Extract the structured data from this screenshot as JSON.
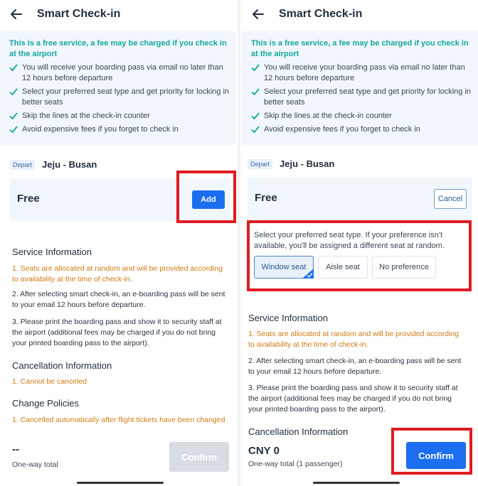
{
  "left": {
    "header": {
      "title": "Smart Check-in"
    },
    "notice": {
      "title": "This is a free service, a fee may be charged if you check in at the airport",
      "benefits": [
        "You will receive your boarding pass via email no later than 12 hours before departure",
        "Select your preferred seat type and get priority for locking in better seats",
        "Skip the lines at the check-in counter",
        "Avoid expensive fees if you forget to check in"
      ]
    },
    "route": {
      "badge": "Depart",
      "text": "Jeju - Busan"
    },
    "price": {
      "label": "Free",
      "add_label": "Add"
    },
    "service": {
      "title": "Service Information",
      "items": [
        "1. Seats are allocated at random and will be provided according to availability at the time of check-in.",
        "2. After selecting smart check-in, an e-boarding pass will be sent to your email 12 hours before departure.",
        "3. Please print the boarding pass and show it to security staff at the airport (additional fees may be charged if you do not bring your printed boarding pass to the airport)."
      ]
    },
    "cancellation": {
      "title": "Cancellation Information",
      "text": "1. Cannot be canceled"
    },
    "change": {
      "title": "Change Policies",
      "text": "1. Cancelled automatically after flight tickets have been changed"
    },
    "total": {
      "amount": "--",
      "label": "One-way total",
      "confirm_label": "Confirm"
    }
  },
  "right": {
    "header": {
      "title": "Smart Check-in"
    },
    "notice": {
      "title": "This is a free service, a fee may be charged if you check in at the airport",
      "benefits": [
        "You will receive your boarding pass via email no later than 12 hours before departure",
        "Select your preferred seat type and get priority for locking in better seats",
        "Skip the lines at the check-in counter",
        "Avoid expensive fees if you forget to check in"
      ]
    },
    "route": {
      "badge": "Depart",
      "text": "Jeju - Busan"
    },
    "price": {
      "label": "Free",
      "cancel_label": "Cancel"
    },
    "seat": {
      "prompt": "Select your preferred seat type. If your preference isn't available, you'll be assigned a different seat at random.",
      "options": [
        "Window seat",
        "Aisle seat",
        "No preference"
      ],
      "selected": "Window seat"
    },
    "service": {
      "title": "Service Information",
      "items": [
        "1. Seats are allocated at random and will be provided according to availability at the time of check-in.",
        "2. After selecting smart check-in, an e-boarding pass will be sent to your email 12 hours before departure.",
        "3. Please print the boarding pass and show it to security staff at the airport (additional fees may be charged if you do not bring your printed boarding pass to the airport)."
      ]
    },
    "cancellation": {
      "title": "Cancellation Information"
    },
    "total": {
      "amount": "CNY 0",
      "label": "One-way total (1 passenger)",
      "confirm_label": "Confirm"
    }
  },
  "colors": {
    "accent": "#1b6ef0",
    "teal": "#14a79d",
    "orange": "#d17a12",
    "highlight": "#e01b22"
  },
  "icons": {
    "back": "arrow-left-icon",
    "check": "check-icon",
    "selected": "check-corner-icon"
  }
}
